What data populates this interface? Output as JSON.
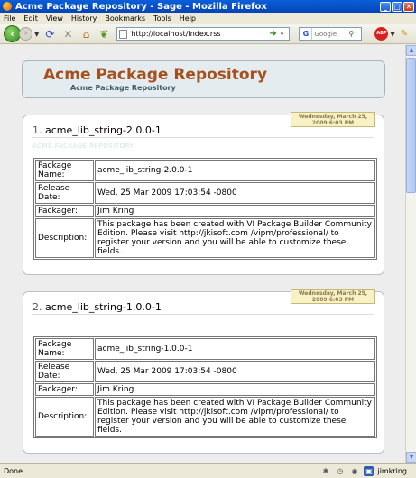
{
  "window": {
    "title": "Acme Package Repository - Sage - Mozilla Firefox",
    "minimize": "_",
    "maximize": "□",
    "close": "✕"
  },
  "menu": [
    "File",
    "Edit",
    "View",
    "History",
    "Bookmarks",
    "Tools",
    "Help"
  ],
  "toolbar": {
    "url": "http://localhost/index.rss",
    "search_placeholder": "Google",
    "search_engine": "G",
    "abp": "ABP"
  },
  "page": {
    "title": "Acme Package Repository",
    "subtitle": "Acme Package Repository",
    "entries": [
      {
        "number": "1.",
        "name": "acme_lib_string-2.0.0-1",
        "date_line1": "Wednesday, March 25,",
        "date_line2": "2009 6:03 PM",
        "ghost": "ACME PACKAGE REPOSITORY",
        "rows": [
          {
            "key": "Package Name:",
            "value": "acme_lib_string-2.0.0-1"
          },
          {
            "key": "Release Date:",
            "value": "Wed, 25 Mar 2009 17:03:54 -0800"
          },
          {
            "key": "Packager:",
            "value": "Jim Kring"
          },
          {
            "key": "Description:",
            "value": "This package has been created with VI Package Builder Community Edition. Please visit http://jkisoft.com /vipm/professional/ to register your version and you will be able to customize these fields."
          }
        ]
      },
      {
        "number": "2.",
        "name": "acme_lib_string-1.0.0-1",
        "date_line1": "Wednesday, March 25,",
        "date_line2": "2009 6:03 PM",
        "rows": [
          {
            "key": "Package Name:",
            "value": "acme_lib_string-1.0.0-1"
          },
          {
            "key": "Release Date:",
            "value": "Wed, 25 Mar 2009 17:03:54 -0800"
          },
          {
            "key": "Packager:",
            "value": "Jim Kring"
          },
          {
            "key": "Description:",
            "value": "This package has been created with VI Package Builder Community Edition. Please visit http://jkisoft.com /vipm/professional/ to register your version and you will be able to customize these fields."
          }
        ]
      }
    ]
  },
  "status": {
    "text": "Done",
    "user": "jimkring"
  }
}
